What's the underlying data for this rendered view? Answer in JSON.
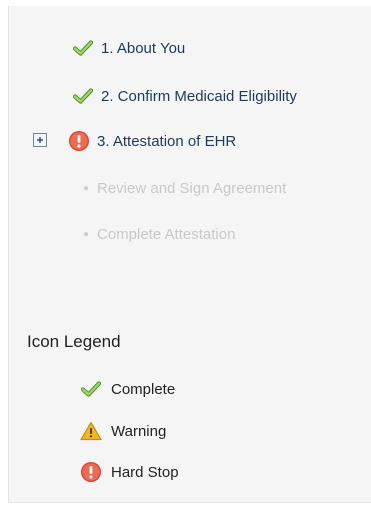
{
  "steps": [
    {
      "label": "1. About You",
      "status": "complete",
      "icon": "check-icon"
    },
    {
      "label": "2. Confirm Medicaid Eligibility",
      "status": "complete",
      "icon": "check-icon"
    },
    {
      "label": "3. Attestation of EHR",
      "status": "hard-stop",
      "icon": "hard-stop-icon",
      "expandable": true
    },
    {
      "label": "Review and Sign Agreement",
      "status": "disabled"
    },
    {
      "label": "Complete Attestation",
      "status": "disabled"
    }
  ],
  "legend": {
    "title": "Icon Legend",
    "items": [
      {
        "label": "Complete",
        "icon": "check-icon"
      },
      {
        "label": "Warning",
        "icon": "warning-icon"
      },
      {
        "label": "Hard Stop",
        "icon": "hard-stop-icon"
      }
    ]
  },
  "colors": {
    "complete_green": "#6fb63a",
    "warning_yellow": "#f4c21c",
    "hard_stop_red": "#e2533d",
    "link_text": "#1e3a5f"
  }
}
